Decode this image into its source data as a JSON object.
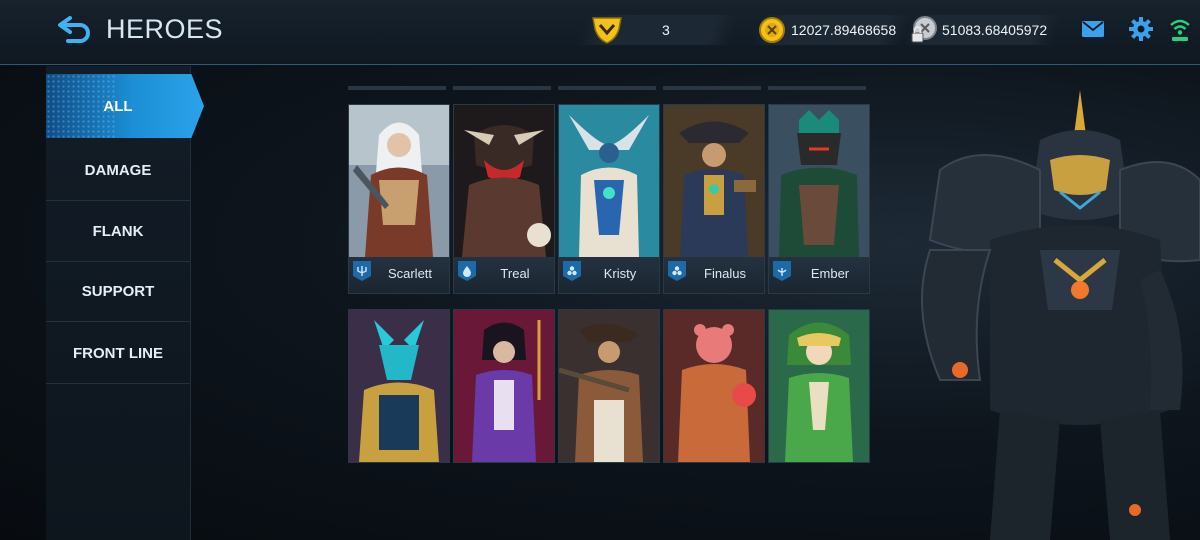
{
  "header": {
    "title": "HEROES",
    "rank_value": "3",
    "gold_value": "12027.89468658",
    "silver_value": "51083.68405972",
    "icons": [
      "back-arrow-icon",
      "rank-shield-icon",
      "gold-coin-icon",
      "locked-coin-icon",
      "mail-icon",
      "gear-icon",
      "signal-icon"
    ]
  },
  "sidebar": {
    "items": [
      {
        "label": "ALL",
        "active": true
      },
      {
        "label": "DAMAGE",
        "active": false
      },
      {
        "label": "FLANK",
        "active": false
      },
      {
        "label": "SUPPORT",
        "active": false
      },
      {
        "label": "FRONT LINE",
        "active": false
      }
    ]
  },
  "heroes": {
    "row1": [
      {
        "name": "Scarlett",
        "role_icon": "trident-icon"
      },
      {
        "name": "Treal",
        "role_icon": "drop-icon"
      },
      {
        "name": "Kristy",
        "role_icon": "hex-cluster-icon"
      },
      {
        "name": "Finalus",
        "role_icon": "hex-cluster-icon"
      },
      {
        "name": "Ember",
        "role_icon": "trident-icon"
      }
    ],
    "row2_count": 5
  },
  "colors": {
    "accent": "#1c8fd6",
    "gold": "#f2c21b",
    "background": "#0e151d"
  }
}
